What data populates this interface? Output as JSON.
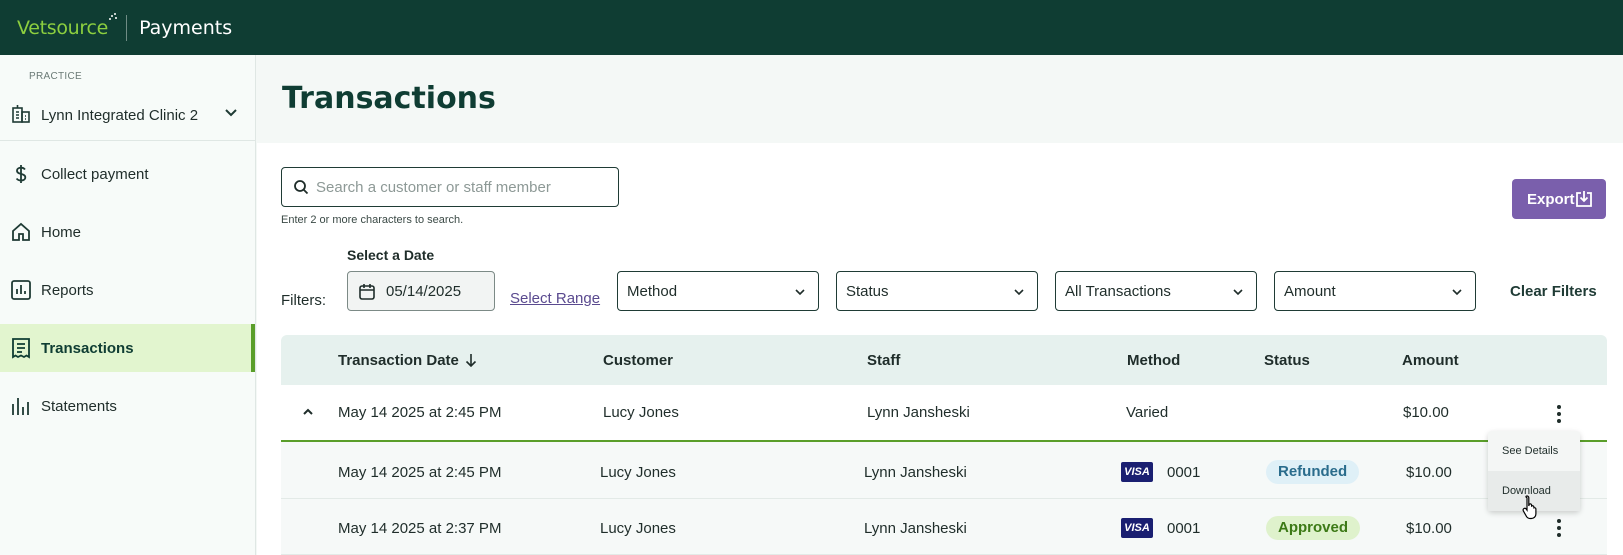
{
  "header": {
    "brand": "Vetsource",
    "product": "Payments"
  },
  "sidebar": {
    "practice_label": "PRACTICE",
    "practice_name": "Lynn Integrated Clinic 2",
    "items": [
      {
        "label": "Collect payment",
        "icon": "dollar-icon"
      },
      {
        "label": "Home",
        "icon": "home-icon"
      },
      {
        "label": "Reports",
        "icon": "reports-icon"
      },
      {
        "label": "Transactions",
        "icon": "receipt-icon",
        "active": true
      },
      {
        "label": "Statements",
        "icon": "bar-chart-icon"
      }
    ]
  },
  "page": {
    "title": "Transactions"
  },
  "search": {
    "placeholder": "Search a customer or staff member",
    "value": "",
    "help": "Enter 2 or more characters to search."
  },
  "export": {
    "label": "Export"
  },
  "filters": {
    "label": "Filters:",
    "date_label": "Select a Date",
    "date_value": "05/14/2025",
    "select_range": "Select Range",
    "method": "Method",
    "status": "Status",
    "type": "All Transactions",
    "amount": "Amount",
    "clear": "Clear Filters"
  },
  "table": {
    "columns": [
      "Transaction Date",
      "Customer",
      "Staff",
      "Method",
      "Status",
      "Amount"
    ],
    "parent": {
      "date": "May 14 2025 at 2:45 PM",
      "customer": "Lucy Jones",
      "staff": "Lynn Jansheski",
      "method": "Varied",
      "amount": "$10.00"
    },
    "children": [
      {
        "date": "May 14 2025 at 2:45 PM",
        "customer": "Lucy Jones",
        "staff": "Lynn Jansheski",
        "card": "VISA",
        "last4": "0001",
        "status": "Refunded",
        "amount": "$10.00"
      },
      {
        "date": "May 14 2025 at 2:37 PM",
        "customer": "Lucy Jones",
        "staff": "Lynn Jansheski",
        "card": "VISA",
        "last4": "0001",
        "status": "Approved",
        "amount": "$10.00"
      }
    ]
  },
  "row_menu": {
    "items": [
      "See Details",
      "Download"
    ]
  },
  "colors": {
    "topbar": "#0f3d33",
    "brand": "#8ccf3f",
    "accent_purple": "#7a5fac",
    "active_nav": "#e2f5cf",
    "active_border": "#5a9e2a"
  }
}
